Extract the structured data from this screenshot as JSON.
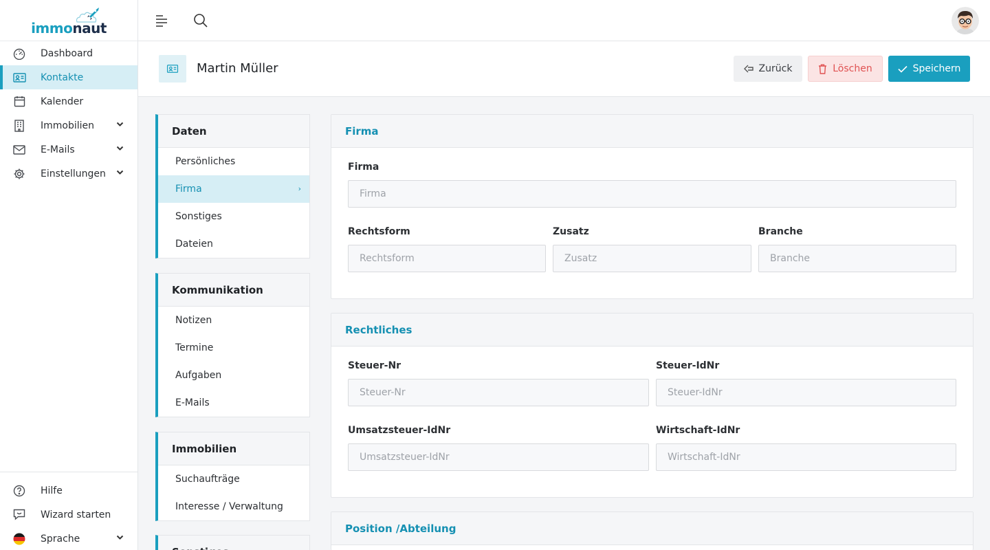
{
  "brand": {
    "logo_part1": "immo",
    "logo_part2": "naut"
  },
  "sidebar": {
    "items": [
      {
        "label": "Dashboard",
        "icon": "gauge-icon"
      },
      {
        "label": "Kontakte",
        "icon": "contact-card-icon"
      },
      {
        "label": "Kalender",
        "icon": "calendar-icon"
      },
      {
        "label": "Immobilien",
        "icon": "building-icon"
      },
      {
        "label": "E-Mails",
        "icon": "envelope-icon"
      },
      {
        "label": "Einstellungen",
        "icon": "gear-icon"
      }
    ],
    "bottom_items": [
      {
        "label": "Hilfe",
        "icon": "help-icon"
      },
      {
        "label": "Wizard starten",
        "icon": "chat-icon"
      },
      {
        "label": "Sprache",
        "icon": "flag-de-icon"
      }
    ]
  },
  "header": {
    "title": "Martin Müller",
    "back_label": "Zurück",
    "delete_label": "Löschen",
    "save_label": "Speichern"
  },
  "sections": [
    {
      "title": "Daten",
      "items": [
        "Persönliches",
        "Firma",
        "Sonstiges",
        "Dateien"
      ]
    },
    {
      "title": "Kommunikation",
      "items": [
        "Notizen",
        "Termine",
        "Aufgaben",
        "E-Mails"
      ]
    },
    {
      "title": "Immobilien",
      "items": [
        "Suchaufträge",
        "Interesse / Verwaltung"
      ]
    },
    {
      "title": "Sonstiges"
    }
  ],
  "firma_card": {
    "title": "Firma",
    "firma": {
      "label": "Firma",
      "placeholder": "Firma"
    },
    "rechtsform": {
      "label": "Rechtsform",
      "placeholder": "Rechtsform"
    },
    "zusatz": {
      "label": "Zusatz",
      "placeholder": "Zusatz"
    },
    "branche": {
      "label": "Branche",
      "placeholder": "Branche"
    }
  },
  "rechtliches_card": {
    "title": "Rechtliches",
    "steuer_nr": {
      "label": "Steuer-Nr",
      "placeholder": "Steuer-Nr"
    },
    "steuer_idnr": {
      "label": "Steuer-IdNr",
      "placeholder": "Steuer-IdNr"
    },
    "umsatzsteuer_idnr": {
      "label": "Umsatzsteuer-IdNr",
      "placeholder": "Umsatzsteuer-IdNr"
    },
    "wirtschaft_idnr": {
      "label": "Wirtschaft-IdNr",
      "placeholder": "Wirtschaft-IdNr"
    }
  },
  "position_card": {
    "title": "Position /Abteilung"
  },
  "colors": {
    "accent": "#1a9fbf",
    "active_bg": "#d6eef5",
    "danger": "#e05252"
  }
}
